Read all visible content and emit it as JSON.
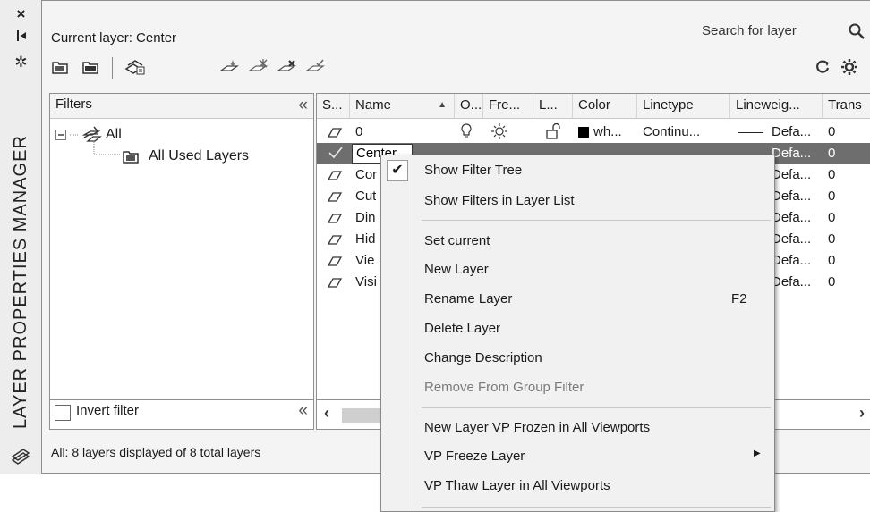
{
  "palette": {
    "title": "LAYER PROPERTIES MANAGER",
    "close_glyph": "×",
    "autohide_glyph": "⁞◂",
    "props_glyph": "✲"
  },
  "header": {
    "current_layer": "Current layer: Center",
    "search_placeholder": "Search for layer"
  },
  "filters": {
    "title": "Filters",
    "collapse_glyph": "«",
    "tree": [
      {
        "label": "All",
        "icon": "filter-all-icon"
      },
      {
        "label": "All Used Layers",
        "icon": "filter-used-icon"
      }
    ],
    "invert_label": "Invert filter"
  },
  "status_text": "All: 8 layers displayed of 8 total layers",
  "columns": [
    "S...",
    "Name",
    "O...",
    "Fre...",
    "L...",
    "Color",
    "Linetype",
    "Lineweig...",
    "Trans"
  ],
  "rows": [
    {
      "name": "0",
      "color": "wh...",
      "linetype": "Continu...",
      "lineweight": "Defa...",
      "trans": "0",
      "selected": false,
      "has_details": true
    },
    {
      "name": "Center",
      "color": "",
      "linetype": "",
      "lineweight": "Defa...",
      "trans": "0",
      "selected": true,
      "has_details": false
    },
    {
      "name": "Cor",
      "lineweight": "Defa...",
      "trans": "0",
      "selected": false
    },
    {
      "name": "Cut",
      "lineweight": "Defa...",
      "trans": "0",
      "selected": false
    },
    {
      "name": "Din",
      "lineweight": "Defa...",
      "trans": "0",
      "selected": false
    },
    {
      "name": "Hid",
      "lineweight": "Defa...",
      "trans": "0",
      "selected": false
    },
    {
      "name": "Vie",
      "lineweight": "Defa...",
      "trans": "0",
      "selected": false
    },
    {
      "name": "Visi",
      "lineweight": "Defa...",
      "trans": "0",
      "selected": false
    }
  ],
  "context_menu": {
    "items": [
      {
        "label": "Show Filter Tree",
        "checked": true
      },
      {
        "label": "Show Filters in Layer List"
      },
      {
        "separator": true
      },
      {
        "label": "Set current"
      },
      {
        "label": "New Layer"
      },
      {
        "label": "Rename Layer",
        "shortcut": "F2"
      },
      {
        "label": "Delete Layer"
      },
      {
        "label": "Change Description"
      },
      {
        "label": "Remove From Group Filter",
        "disabled": true
      },
      {
        "separator": true
      },
      {
        "label": "New Layer VP Frozen in All Viewports"
      },
      {
        "label": "VP Freeze Layer",
        "submenu": true
      },
      {
        "label": "VP Thaw Layer in All Viewports"
      },
      {
        "separator": true
      }
    ]
  },
  "colors": {
    "selected_row": "#6e6e6e",
    "panel_bg": "#f4f4f4",
    "menu_bg": "#f1f1f1"
  }
}
